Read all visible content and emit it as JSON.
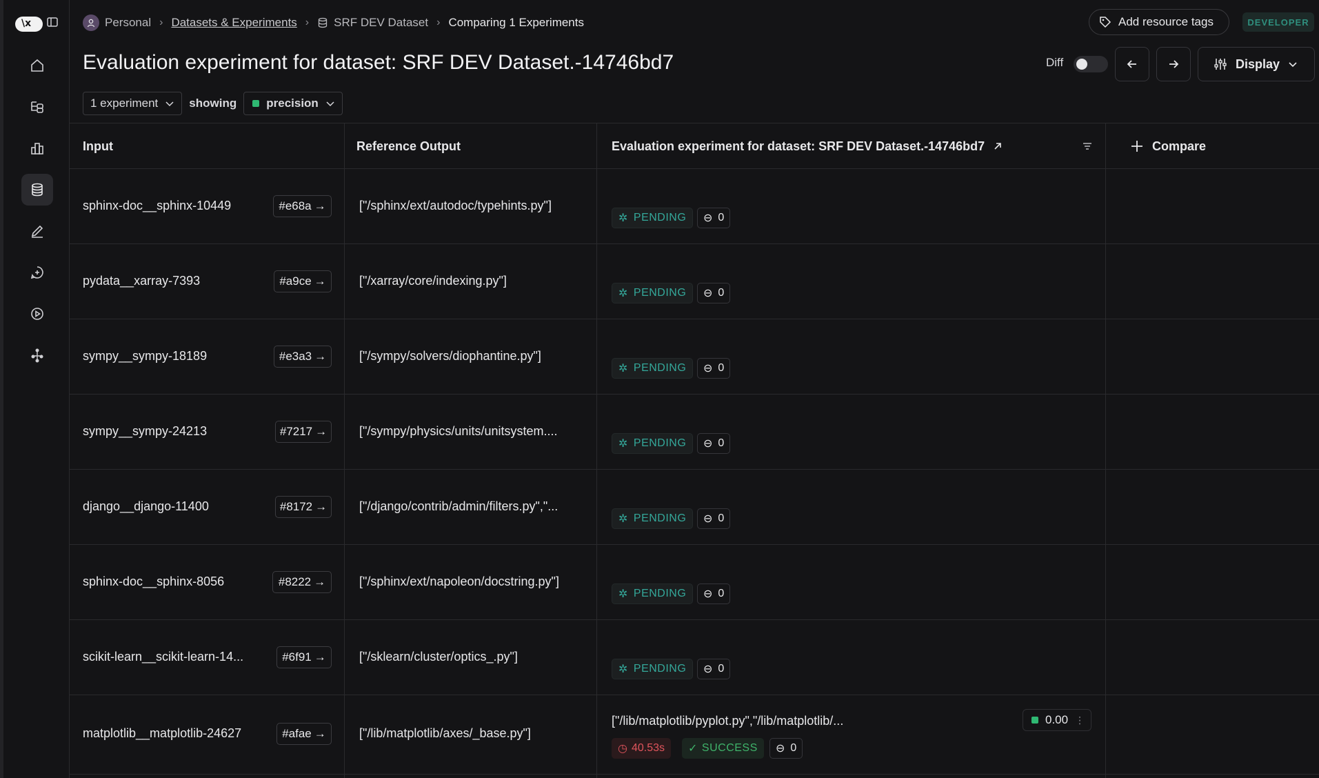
{
  "logo": {
    "text": "\\x"
  },
  "breadcrumb": {
    "items": [
      "Personal",
      "Datasets & Experiments",
      "SRF DEV Dataset",
      "Comparing 1 Experiments"
    ]
  },
  "header": {
    "add_tags_label": "Add resource tags",
    "badge": "DEVELOPER",
    "title": "Evaluation experiment for dataset: SRF DEV Dataset.-14746bd7",
    "diff_label": "Diff",
    "display_label": "Display"
  },
  "filters": {
    "experiments": "1 experiment",
    "showing": "showing",
    "metric": "precision"
  },
  "table": {
    "columns": {
      "input": "Input",
      "reference": "Reference Output",
      "experiment": "Evaluation experiment for dataset: SRF DEV Dataset.-14746bd7",
      "compare": "Compare"
    },
    "rows": [
      {
        "input": "sphinx-doc__sphinx-10449",
        "id": "#e68a",
        "reference": "[\"/sphinx/ext/autodoc/typehints.py\"]",
        "status": "PENDING",
        "count": "0"
      },
      {
        "input": "pydata__xarray-7393",
        "id": "#a9ce",
        "reference": "[\"/xarray/core/indexing.py\"]",
        "status": "PENDING",
        "count": "0"
      },
      {
        "input": "sympy__sympy-18189",
        "id": "#e3a3",
        "reference": "[\"/sympy/solvers/diophantine.py\"]",
        "status": "PENDING",
        "count": "0"
      },
      {
        "input": "sympy__sympy-24213",
        "id": "#7217",
        "reference": "[\"/sympy/physics/units/unitsystem....",
        "status": "PENDING",
        "count": "0"
      },
      {
        "input": "django__django-11400",
        "id": "#8172",
        "reference": "[\"/django/contrib/admin/filters.py\",\"...",
        "status": "PENDING",
        "count": "0"
      },
      {
        "input": "sphinx-doc__sphinx-8056",
        "id": "#8222",
        "reference": "[\"/sphinx/ext/napoleon/docstring.py\"]",
        "status": "PENDING",
        "count": "0"
      },
      {
        "input": "scikit-learn__scikit-learn-14...",
        "id": "#6f91",
        "reference": "[\"/sklearn/cluster/optics_.py\"]",
        "status": "PENDING",
        "count": "0"
      },
      {
        "input": "matplotlib__matplotlib-24627",
        "id": "#afae",
        "reference": "[\"/lib/matplotlib/axes/_base.py\"]",
        "output": "[\"/lib/matplotlib/pyplot.py\",\"/lib/matplotlib/...",
        "score": "0.00",
        "latency": "40.53s",
        "status": "SUCCESS",
        "count": "0"
      }
    ]
  },
  "colors": {
    "accent_teal": "#34a89a",
    "success": "#3fb36a",
    "error": "#e0545c",
    "metric": "#2fb872"
  }
}
